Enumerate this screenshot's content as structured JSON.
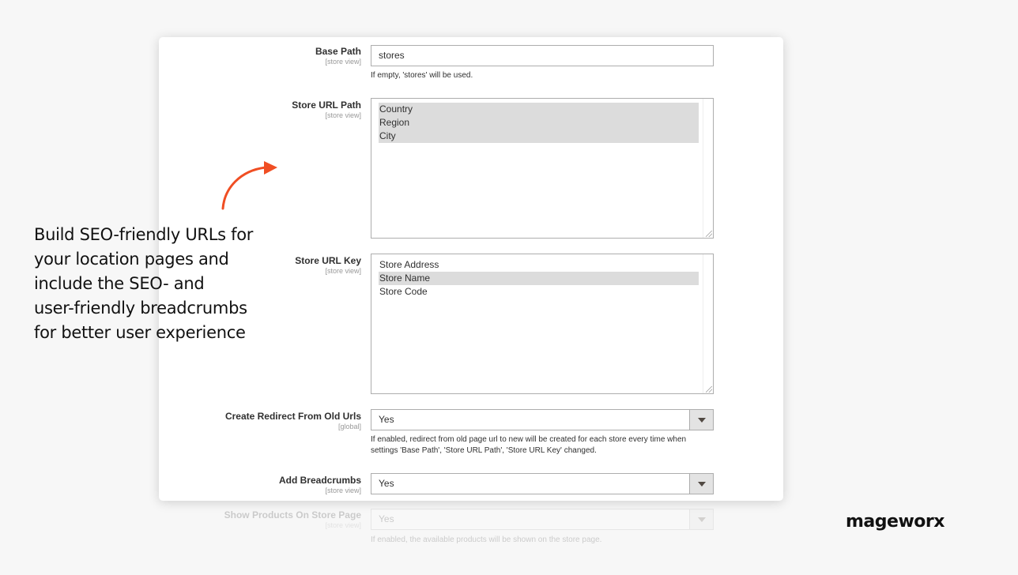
{
  "form": {
    "base_path": {
      "label": "Base Path",
      "scope": "[store view]",
      "value": "stores",
      "note": "If empty, 'stores' will be used."
    },
    "store_url_path": {
      "label": "Store URL Path",
      "scope": "[store view]",
      "options": [
        {
          "label": "Country",
          "selected": true
        },
        {
          "label": "Region",
          "selected": true
        },
        {
          "label": "City",
          "selected": true
        }
      ]
    },
    "store_url_key": {
      "label": "Store URL Key",
      "scope": "[store view]",
      "options": [
        {
          "label": "Store Address",
          "selected": false
        },
        {
          "label": "Store Name",
          "selected": true
        },
        {
          "label": "Store Code",
          "selected": false
        }
      ]
    },
    "create_redirect": {
      "label": "Create Redirect From Old Urls",
      "scope": "[global]",
      "value": "Yes",
      "note_line1": "If enabled, redirect from old page url to new will be created for each store every time when",
      "note_line2": "settings 'Base Path', 'Store URL Path', 'Store URL Key' changed."
    },
    "add_breadcrumbs": {
      "label": "Add Breadcrumbs",
      "scope": "[store view]",
      "value": "Yes"
    },
    "show_products": {
      "label": "Show Products On Store Page",
      "scope": "[store view]",
      "value": "Yes",
      "note": "If enabled, the available products will be shown on the store page."
    }
  },
  "promo": {
    "line1": "Build SEO-friendly URLs for",
    "line2": "your location pages and",
    "line3": "include the SEO- and",
    "line4": "user-friendly breadcrumbs",
    "line5": "for better user experience",
    "arrow_color": "#f04e23"
  },
  "brand": {
    "logo_text": "mageworx"
  }
}
